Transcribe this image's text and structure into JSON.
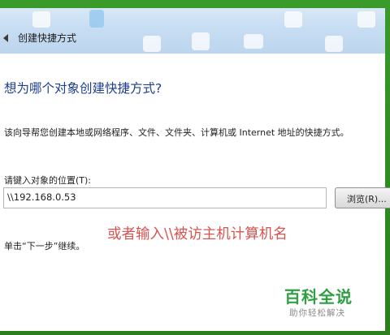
{
  "window": {
    "title": "创建快捷方式",
    "heading": "想为哪个对象创建快捷方式?",
    "description": "该向导帮您创建本地或网络程序、文件、文件夹、计算机或 Internet 地址的快捷方式。",
    "field_label": "请键入对象的位置(T):",
    "location_value": "\\\\192.168.0.53",
    "browse_label": "浏览(R)...",
    "hint": "单击“下一步”继续。"
  },
  "annotation": "或者输入\\\\被访主机计算机名",
  "watermark": {
    "title": "百科全说",
    "subtitle": "助你轻松解决"
  },
  "colors": {
    "frame": "#2e8a1e",
    "heading": "#1e3f8f",
    "annotation": "#d9534f",
    "watermark": "#2ea043"
  },
  "icons": [
    "back-arrow-icon"
  ]
}
